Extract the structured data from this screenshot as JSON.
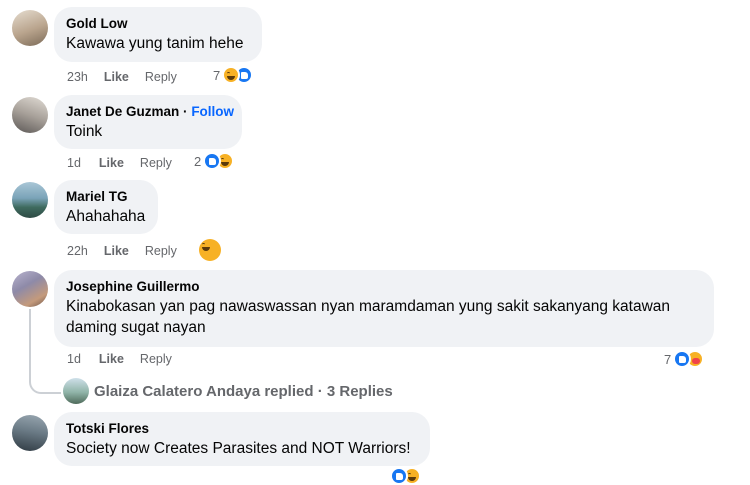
{
  "comments": [
    {
      "author": "Gold Low",
      "text": "Kawawa yung tanim hehe",
      "time": "23h",
      "like_label": "Like",
      "reply_label": "Reply",
      "reaction_count": "7",
      "avatar_colors": [
        "#d8cfc0",
        "#8b7b68"
      ]
    },
    {
      "author": "Janet De Guzman",
      "separator": "·",
      "follow_label": "Follow",
      "text": "Toink",
      "time": "1d",
      "like_label": "Like",
      "reply_label": "Reply",
      "reaction_count": "2",
      "avatar_colors": [
        "#cfc8be",
        "#6e6a66"
      ]
    },
    {
      "author": "Mariel TG",
      "text": "Ahahahaha",
      "time": "22h",
      "like_label": "Like",
      "reply_label": "Reply",
      "reaction_count": "",
      "avatar_colors": [
        "#7aa3b8",
        "#3c5f5a"
      ]
    },
    {
      "author": "Josephine Guillermo",
      "text": "Kinabokasan yan pag nawaswassan nyan maramdaman yung sakit sakanyang katawan daming sugat nayan",
      "time": "1d",
      "like_label": "Like",
      "reply_label": "Reply",
      "reaction_count": "7",
      "avatar_colors": [
        "#8e8aa8",
        "#b08c74"
      ],
      "replies_summary": "Glaiza Calatero Andaya replied · 3 Replies"
    },
    {
      "author": "Totski Flores",
      "text": "Society now Creates Parasites and NOT Warriors!",
      "time": "",
      "like_label": "",
      "reply_label": "",
      "reaction_count": "",
      "avatar_colors": [
        "#6b7b86",
        "#2f3a42"
      ]
    }
  ],
  "colors": {
    "bubble": "#f0f2f5",
    "secondary_text": "#65676b",
    "link": "#0866ff",
    "like": "#1877f2",
    "haha": "#f7b125"
  },
  "icons": [
    "haha-icon",
    "like-icon",
    "care-icon"
  ]
}
